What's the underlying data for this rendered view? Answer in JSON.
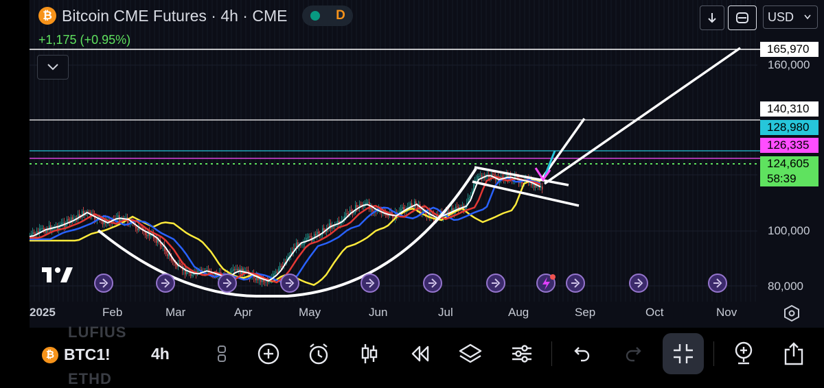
{
  "header": {
    "coin_glyph": "₿",
    "title": "Bitcoin CME Futures · 4h · CME",
    "badge_letter": "D",
    "change": "+1,175 (+0.95%)"
  },
  "toolbar_top": {
    "currency": "USD",
    "download_icon": "arrow-down-icon",
    "crop_icon": "rounded-square-icon"
  },
  "price_axis": {
    "labels": [
      "160,000",
      "100,000",
      "80,000"
    ],
    "tags": [
      {
        "value": "165,970",
        "bg": "#ffffff",
        "fg": "#000000"
      },
      {
        "value": "140,310",
        "bg": "#ffffff",
        "fg": "#000000"
      },
      {
        "value": "128,980",
        "bg": "#26c6da",
        "fg": "#000000"
      },
      {
        "value": "126,335",
        "bg": "#ff4dff",
        "fg": "#000000"
      },
      {
        "value": "124,605",
        "bg": "#5fe25f",
        "fg": "#000000"
      },
      {
        "value": "58:39",
        "bg": "#5fe25f",
        "fg": "#000000"
      }
    ]
  },
  "time_axis": {
    "labels": [
      "2025",
      "Feb",
      "Mar",
      "Apr",
      "May",
      "Jun",
      "Jul",
      "Aug",
      "Sep",
      "Oct",
      "Nov"
    ]
  },
  "colors": {
    "chart_bg": "#0c0e17",
    "up": "#26a69a",
    "down": "#ef5350",
    "ema_yellow": "#ffeb3b",
    "ema_blue": "#2962ff",
    "ema_red": "#e53935",
    "ema_white": "#ffffff",
    "line_cyan": "#26c6da",
    "line_magenta": "#ff4dff",
    "line_green": "#5fe25f",
    "event_purple": "#7e57c2"
  },
  "bottom_bar": {
    "symbol_coin": "₿",
    "symbol": "BTC1!",
    "interval": "4h",
    "ghost_top": "LUFIUS",
    "ghost_bottom": "ETHD",
    "icons": [
      "indicators-icon",
      "add-icon",
      "alert-icon",
      "candles-icon",
      "replay-icon",
      "layers-icon",
      "settings-sliders-icon",
      "undo-icon",
      "redo-icon",
      "fullscreen-exit-icon",
      "pin-add-icon",
      "share-icon"
    ]
  }
}
